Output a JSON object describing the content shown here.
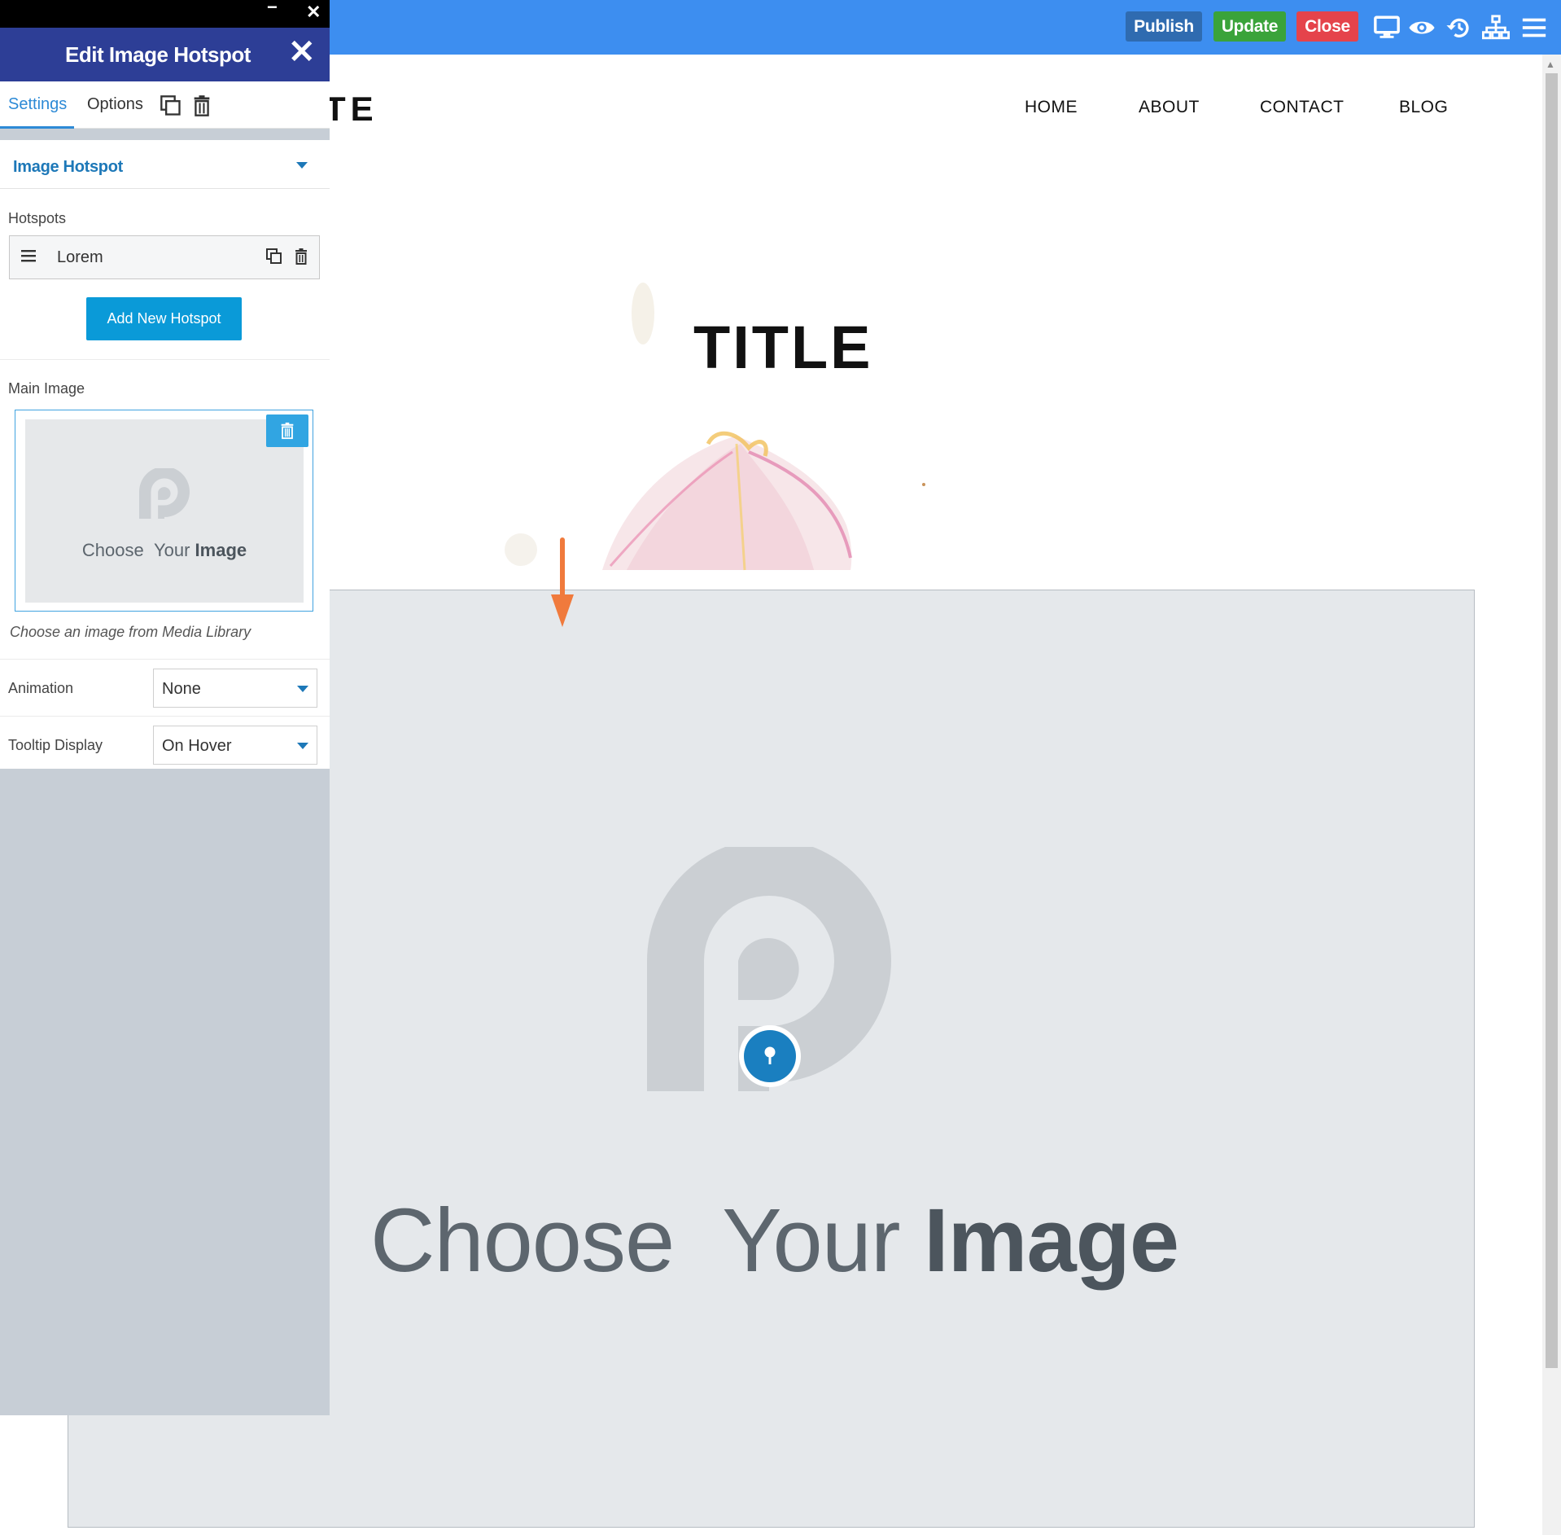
{
  "toolbar": {
    "publish_label": "Publish",
    "update_label": "Update",
    "close_label": "Close",
    "colors": {
      "bar": "#3d8ef0",
      "publish": "#2f6bb0",
      "update": "#3aa33a",
      "close": "#e5434b"
    },
    "icons": [
      "desktop-icon",
      "eye-icon",
      "history-icon",
      "sitemap-icon",
      "hamburger-menu-icon"
    ]
  },
  "site": {
    "logo_fragment": "TE",
    "nav": [
      "HOME",
      "ABOUT",
      "CONTACT",
      "BLOG"
    ],
    "title": "TITLE"
  },
  "canvas": {
    "placeholder": {
      "choose": "Choose",
      "your": "Your",
      "image": "Image"
    },
    "hotspot_icon": "pin-icon",
    "hotspot_color": "#1a7fc0"
  },
  "panel": {
    "title": "Edit Image Hotspot",
    "tabs": {
      "settings": "Settings",
      "options": "Options"
    },
    "section_title": "Image Hotspot",
    "hotspots_label": "Hotspots",
    "hotspots": [
      {
        "name": "Lorem"
      }
    ],
    "add_button": "Add New Hotspot",
    "main_image_label": "Main Image",
    "main_image_placeholder": {
      "choose": "Choose",
      "your": "Your",
      "image": "Image"
    },
    "main_image_hint": "Choose an image from Media Library",
    "animation": {
      "label": "Animation",
      "value": "None"
    },
    "tooltip": {
      "label": "Tooltip Display",
      "value": "On Hover"
    },
    "colors": {
      "header": "#2d3e96",
      "accent": "#2d8ad6",
      "button": "#0a9ad8"
    }
  }
}
